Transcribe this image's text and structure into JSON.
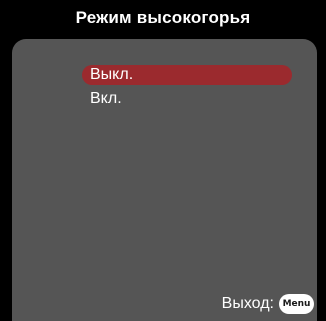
{
  "title": "Режим высокогорья",
  "options": [
    {
      "label": "Выкл.",
      "selected": true
    },
    {
      "label": "Вкл.",
      "selected": false
    }
  ],
  "footer": {
    "exit_label": "Выход:",
    "menu_key": "Menu"
  },
  "colors": {
    "background": "#000000",
    "panel": "#555555",
    "selection": "#9b2a2e",
    "text": "#ffffff"
  }
}
